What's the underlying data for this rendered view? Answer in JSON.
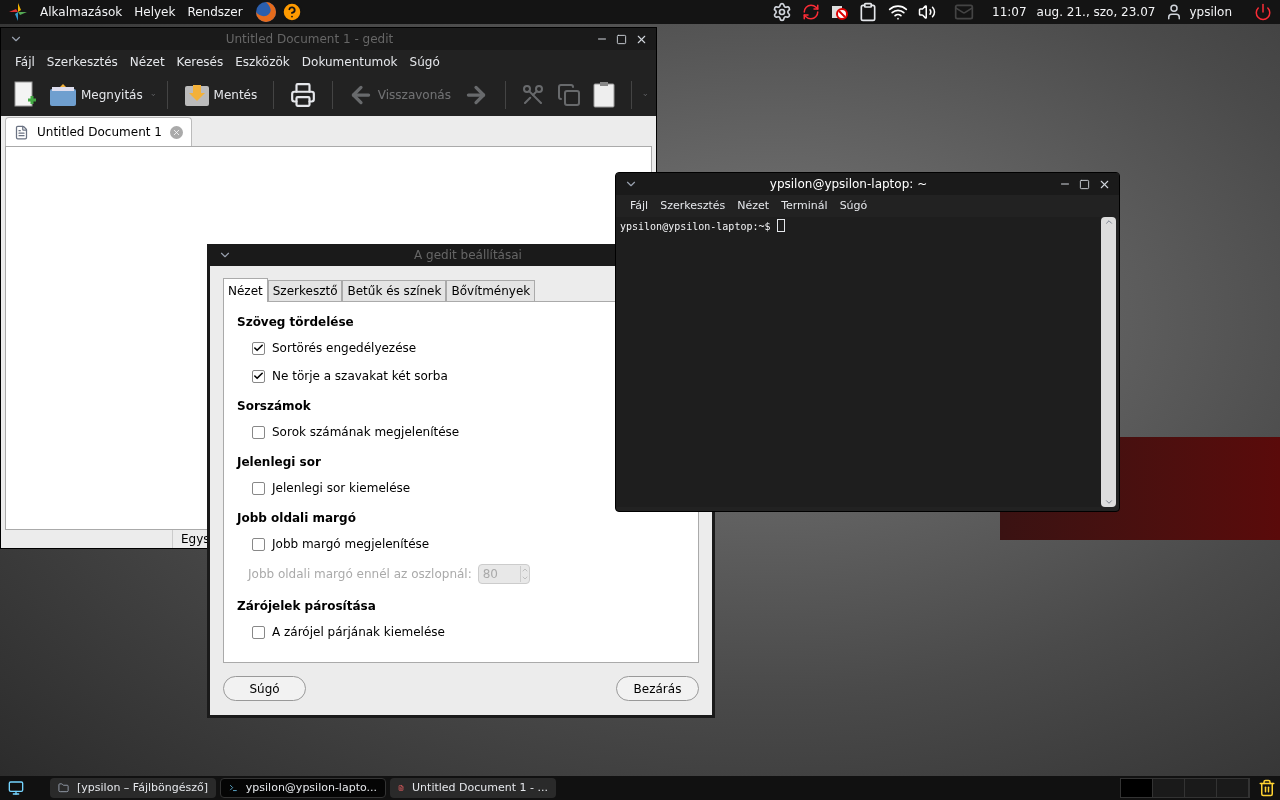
{
  "top_panel": {
    "menus": [
      "Alkalmazások",
      "Helyek",
      "Rendszer"
    ],
    "clock": "11:07",
    "date": "aug. 21., szo, 23.07",
    "user": "ypsilon"
  },
  "gedit": {
    "title": "Untitled Document 1 - gedit",
    "active": false,
    "menu": [
      "Fájl",
      "Szerkesztés",
      "Nézet",
      "Keresés",
      "Eszközök",
      "Dokumentumok",
      "Súgó"
    ],
    "toolbar": [
      {
        "kind": "new",
        "disabled": false
      },
      {
        "kind": "open",
        "label": "Megnyitás",
        "disabled": false
      },
      {
        "kind": "save",
        "label": "Mentés",
        "disabled": false
      },
      {
        "kind": "print",
        "disabled": false
      },
      {
        "kind": "undo",
        "label": "Visszavonás",
        "disabled": true
      },
      {
        "kind": "redo",
        "disabled": true
      },
      {
        "kind": "cut",
        "disabled": true
      },
      {
        "kind": "copy",
        "disabled": true
      },
      {
        "kind": "paste",
        "disabled": false
      }
    ],
    "document_tab": "Untitled Document 1",
    "status_cell": "Egys"
  },
  "preferences": {
    "title": "A gedit beállításai",
    "active": false,
    "tabs": [
      {
        "label": "Nézet",
        "selected": true
      },
      {
        "label": "Szerkesztő",
        "selected": false
      },
      {
        "label": "Betűk és színek",
        "selected": false
      },
      {
        "label": "Bővítmények",
        "selected": false
      }
    ],
    "sections": [
      {
        "heading": "Szöveg tördelése",
        "options": [
          {
            "label": "Sortörés engedélyezése",
            "checked": true
          },
          {
            "label": "Ne törje a szavakat két sorba",
            "checked": true
          }
        ]
      },
      {
        "heading": "Sorszámok",
        "options": [
          {
            "label": "Sorok számának megjelenítése",
            "checked": false
          }
        ]
      },
      {
        "heading": "Jelenlegi sor",
        "options": [
          {
            "label": "Jelenlegi sor kiemelése",
            "checked": false
          }
        ]
      },
      {
        "heading": "Jobb oldali margó",
        "options": [
          {
            "label": "Jobb margó megjelenítése",
            "checked": false
          }
        ],
        "spin": {
          "label": "Jobb oldali margó ennél az oszlopnál:",
          "value": "80",
          "disabled": true
        }
      },
      {
        "heading": "Zárójelek párosítása",
        "options": [
          {
            "label": "A zárójel párjának kiemelése",
            "checked": false
          }
        ]
      }
    ],
    "buttons": [
      "Súgó",
      "Bezárás"
    ]
  },
  "terminal": {
    "title": "ypsilon@ypsilon-laptop: ~",
    "active": true,
    "menu": [
      "Fájl",
      "Szerkesztés",
      "Nézet",
      "Terminál",
      "Súgó"
    ],
    "prompt": "ypsilon@ypsilon-laptop:~$"
  },
  "taskbar": [
    {
      "label": "[ypsilon – Fájlböngésző]",
      "selected": false,
      "kind": "files"
    },
    {
      "label": "ypsilon@ypsilon-lapto...",
      "selected": true,
      "kind": "terminal"
    },
    {
      "label": "Untitled Document 1 - ...",
      "selected": false,
      "kind": "editor"
    }
  ]
}
